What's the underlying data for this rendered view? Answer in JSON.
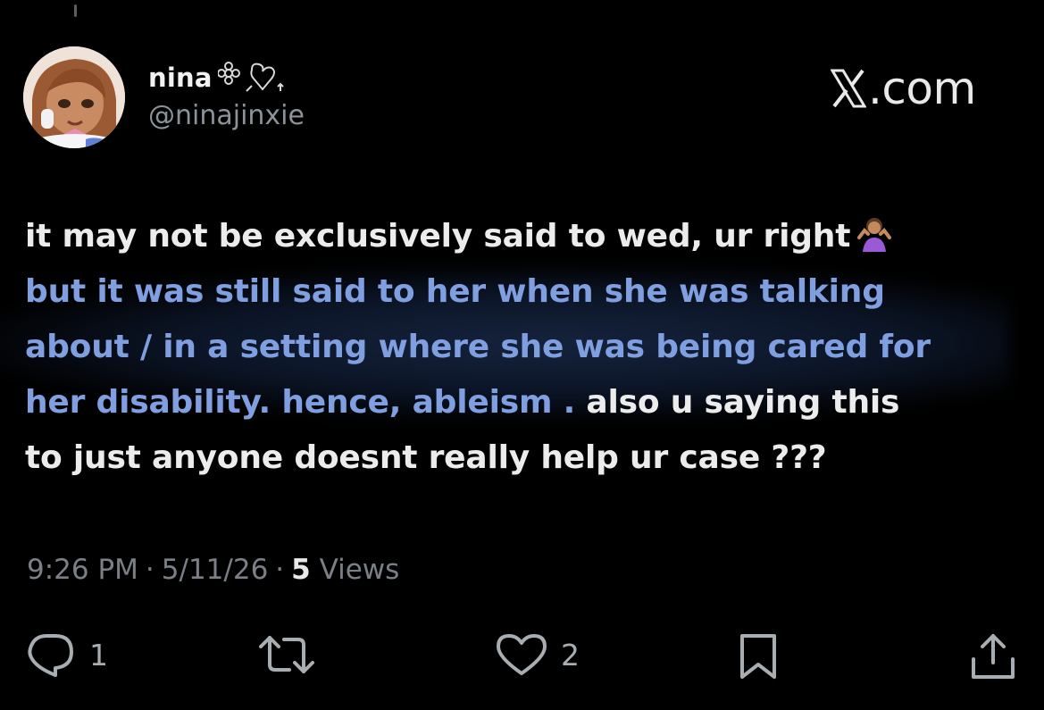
{
  "header": {
    "display_name": "nina",
    "handle": "@ninajinxie",
    "site_logo": ".com"
  },
  "tweet": {
    "line1": "it may not be exclusively said to wed, ur right",
    "line2": "but it was still said to her when she was talking",
    "line3": "about / in a setting where she was being cared for",
    "line4_blue": "her disability. hence, ableism .",
    "line4_white": " also u saying this",
    "line5": "to just anyone doesnt really help ur case ???",
    "emoji": "person-shrugging-emoji"
  },
  "meta": {
    "time": "9:26 PM",
    "date": "5/11/26",
    "views_count": "5",
    "views_label": "Views",
    "separator": "·"
  },
  "actions": {
    "reply_count": "1",
    "repost_count": "",
    "like_count": "2",
    "icons": [
      "reply-icon",
      "repost-icon",
      "like-icon",
      "bookmark-icon",
      "share-icon"
    ]
  },
  "colors": {
    "background": "#000000",
    "text_primary": "#ececec",
    "text_secondary": "#7b8086",
    "highlight_text": "#7f9fe0"
  }
}
